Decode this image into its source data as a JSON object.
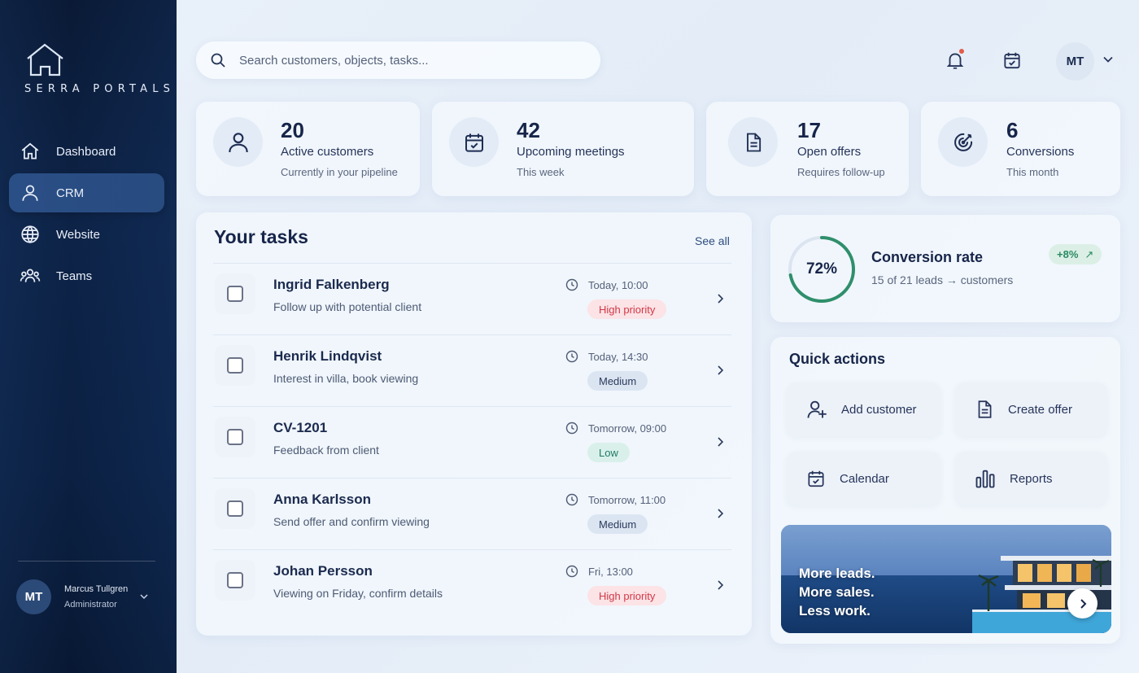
{
  "brand": {
    "name": "SERRA PORTALS"
  },
  "sidebar": {
    "items": [
      {
        "label": "Dashboard",
        "icon": "home-icon"
      },
      {
        "label": "CRM",
        "icon": "user-icon",
        "active": true
      },
      {
        "label": "Website",
        "icon": "globe-icon"
      },
      {
        "label": "Teams",
        "icon": "team-icon"
      }
    ],
    "user": {
      "initials": "MT",
      "name": "Marcus Tullgren",
      "role": "Administrator"
    }
  },
  "header": {
    "search_placeholder": "Search customers, objects, tasks...",
    "avatar_initials": "MT",
    "notification_dot_color": "#e25b4b"
  },
  "stats": [
    {
      "value": "20",
      "label": "Active customers",
      "sub": "Currently in your pipeline",
      "icon": "user-icon"
    },
    {
      "value": "42",
      "label": "Upcoming meetings",
      "sub": "This week",
      "icon": "calendar-icon"
    },
    {
      "value": "17",
      "label": "Open offers",
      "sub": "Requires follow-up",
      "icon": "document-icon"
    },
    {
      "value": "6",
      "label": "Conversions",
      "sub": "This month",
      "icon": "target-icon"
    }
  ],
  "tasks": {
    "title": "Your tasks",
    "see_all": "See all",
    "items": [
      {
        "name": "Ingrid Falkenberg",
        "desc": "Follow up with potential client",
        "time": "Today, 10:00",
        "priority": "High priority",
        "level": "high"
      },
      {
        "name": "Henrik Lindqvist",
        "desc": "Interest in villa, book viewing",
        "time": "Today, 14:30",
        "priority": "Medium",
        "level": "medium"
      },
      {
        "name": "CV-1201",
        "desc": "Feedback from client",
        "time": "Tomorrow, 09:00",
        "priority": "Low",
        "level": "low"
      },
      {
        "name": "Anna Karlsson",
        "desc": "Send offer and confirm viewing",
        "time": "Tomorrow, 11:00",
        "priority": "Medium",
        "level": "medium"
      },
      {
        "name": "Johan Persson",
        "desc": "Viewing on Friday, confirm details",
        "time": "Fri, 13:00",
        "priority": "High priority",
        "level": "high"
      }
    ]
  },
  "conversion": {
    "percent_label": "72%",
    "percent": 72,
    "title": "Conversion rate",
    "sub": "15 of 21 leads → customers",
    "change": "+8%",
    "ring_color": "#2f8f6b"
  },
  "quick_actions": {
    "title": "Quick actions",
    "items": [
      {
        "label": "Add customer",
        "icon": "add-user-icon"
      },
      {
        "label": "Create offer",
        "icon": "document-icon"
      },
      {
        "label": "Calendar",
        "icon": "calendar-icon"
      },
      {
        "label": "Reports",
        "icon": "bar-chart-icon"
      }
    ]
  },
  "promo": {
    "line1": "More leads.",
    "line2": "More sales.",
    "line3": "Less work."
  }
}
